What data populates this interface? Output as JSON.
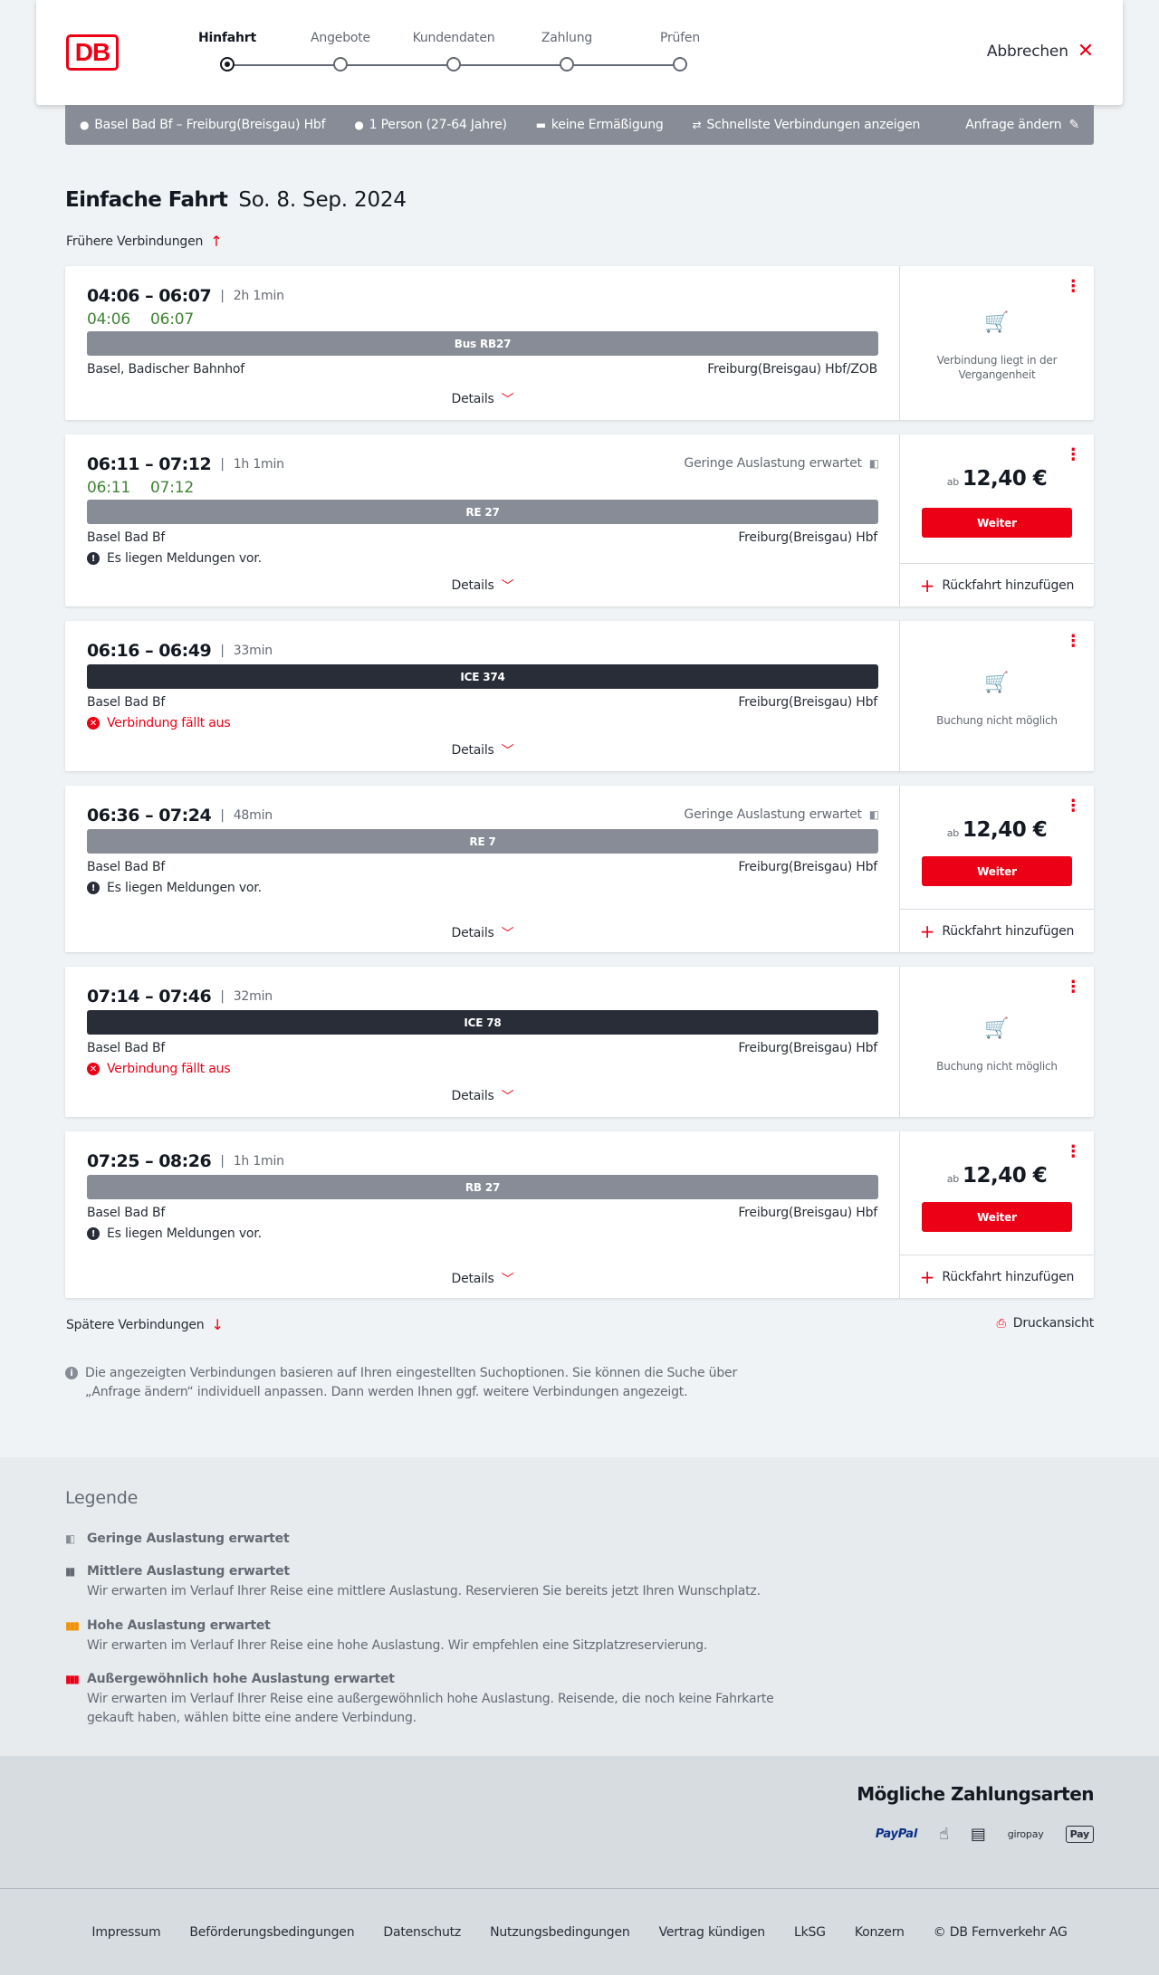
{
  "header": {
    "logo": "DB",
    "steps": [
      "Hinfahrt",
      "Angebote",
      "Kundendaten",
      "Zahlung",
      "Prüfen"
    ],
    "active_step": "Hinfahrt",
    "cancel_label": "Abbrechen"
  },
  "search": {
    "route": "Basel Bad Bf – Freiburg(Breisgau) Hbf",
    "passengers": "1 Person (27-64 Jahre)",
    "discount": "keine Ermäßigung",
    "option": "Schnellste Verbindungen anzeigen",
    "edit_label": "Anfrage ändern"
  },
  "title": {
    "type": "Einfache Fahrt",
    "date": "So. 8. Sep. 2024"
  },
  "earlier_label": "Frühere Verbindungen",
  "later_label": "Spätere Verbindungen",
  "print_label": "Druckansicht",
  "details_label": "Details",
  "continue_label": "Weiter",
  "return_label": "Rückfahrt hinzufügen",
  "price_prefix": "ab",
  "connections": [
    {
      "times": "04:06 – 06:07",
      "duration": "2h 1min",
      "realtime": [
        "04:06",
        "06:07"
      ],
      "train": "Bus RB27",
      "from": "Basel, Badischer Bahnhof",
      "to": "Freiburg(Breisgau) Hbf/ZOB",
      "message": "",
      "load": "",
      "status": "Verbindung liegt in der Vergangenheit"
    },
    {
      "times": "06:11 – 07:12",
      "duration": "1h 1min",
      "realtime": [
        "06:11",
        "07:12"
      ],
      "train": "RE 27",
      "from": "Basel Bad Bf",
      "to": "Freiburg(Breisgau) Hbf",
      "message": "Es liegen Meldungen vor.",
      "load": "Geringe Auslastung erwartet",
      "price": "12,40 €"
    },
    {
      "times": "06:16 – 06:49",
      "duration": "33min",
      "train": "ICE 374",
      "from": "Basel Bad Bf",
      "to": "Freiburg(Breisgau) Hbf",
      "message": "Verbindung fällt aus",
      "status": "Buchung nicht möglich"
    },
    {
      "times": "06:36 – 07:24",
      "duration": "48min",
      "train": "RE 7",
      "from": "Basel Bad Bf",
      "to": "Freiburg(Breisgau) Hbf",
      "message": "Es liegen Meldungen vor.",
      "load": "Geringe Auslastung erwartet",
      "price": "12,40 €"
    },
    {
      "times": "07:14 – 07:46",
      "duration": "32min",
      "train": "ICE 78",
      "from": "Basel Bad Bf",
      "to": "Freiburg(Breisgau) Hbf",
      "message": "Verbindung fällt aus",
      "status": "Buchung nicht möglich"
    },
    {
      "times": "07:25 – 08:26",
      "duration": "1h 1min",
      "train": "RB 27",
      "from": "Basel Bad Bf",
      "to": "Freiburg(Breisgau) Hbf",
      "message": "Es liegen Meldungen vor.",
      "price": "12,40 €"
    }
  ],
  "info_text": "Die angezeigten Verbindungen basieren auf Ihren eingestellten Suchoptionen. Sie können die Suche über „Anfrage ändern“ individuell anpassen. Dann werden Ihnen ggf. weitere Verbindungen angezeigt.",
  "legend": {
    "title": "Legende",
    "items": [
      {
        "title": "Geringe Auslastung erwartet",
        "text": ""
      },
      {
        "title": "Mittlere Auslastung erwartet",
        "text": "Wir erwarten im Verlauf Ihrer Reise eine mittlere Auslastung. Reservieren Sie bereits jetzt Ihren Wunschplatz."
      },
      {
        "title": "Hohe Auslastung erwartet",
        "text": "Wir erwarten im Verlauf Ihrer Reise eine hohe Auslastung. Wir empfehlen eine Sitzplatzreservierung."
      },
      {
        "title": "Außergewöhnlich hohe Auslastung erwartet",
        "text": "Wir erwarten im Verlauf Ihrer Reise eine außergewöhnlich hohe Auslastung. Reisende, die noch keine Fahrkarte gekauft haben, wählen bitte eine andere Verbindung."
      }
    ]
  },
  "payment": {
    "title": "Mögliche Zahlungsarten",
    "methods": [
      "PayPal",
      "giropay",
      "Pay"
    ]
  },
  "footer": {
    "links": [
      "Impressum",
      "Beförderungsbedingungen",
      "Datenschutz",
      "Nutzungsbedingungen",
      "Vertrag kündigen",
      "LkSG",
      "Konzern",
      "© DB Fernverkehr AG"
    ]
  },
  "colors": {
    "brand": "#ec0016",
    "realtime": "#408335",
    "searchbar": "#878c96"
  }
}
